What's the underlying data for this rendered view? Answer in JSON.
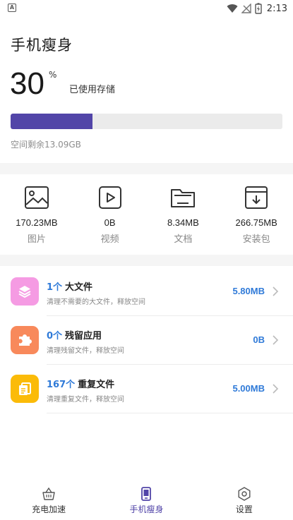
{
  "status_bar": {
    "left_icon": "A",
    "time": "2:13",
    "icons": [
      "wifi-icon",
      "no-signal-icon",
      "battery-charging-icon"
    ]
  },
  "header": {
    "title": "手机瘦身"
  },
  "storage": {
    "percent": "30",
    "unit": "%",
    "label": "已使用存储",
    "used_fraction": 0.3,
    "space_left": "空间剩余13.09GB"
  },
  "categories": [
    {
      "icon": "image-icon",
      "size": "170.23MB",
      "label": "图片"
    },
    {
      "icon": "video-icon",
      "size": "0B",
      "label": "视频"
    },
    {
      "icon": "folder-icon",
      "size": "8.34MB",
      "label": "文档"
    },
    {
      "icon": "package-icon",
      "size": "266.75MB",
      "label": "安装包"
    }
  ],
  "clean_items": [
    {
      "icon": "layers-icon",
      "count": "1个",
      "name": "大文件",
      "desc": "清理不需要的大文件，释放空间",
      "size": "5.80MB",
      "color": "#f59be3"
    },
    {
      "icon": "puzzle-icon",
      "count": "0个",
      "name": "残留应用",
      "desc": "清理残留文件，释放空间",
      "size": "0B",
      "color": "#f8895b"
    },
    {
      "icon": "copy-icon",
      "count": "167个",
      "name": "重复文件",
      "desc": "清理重复文件，释放空间",
      "size": "5.00MB",
      "color": "#fbbb09"
    }
  ],
  "tabs": [
    {
      "icon": "basket-icon",
      "label": "充电加速",
      "active": false
    },
    {
      "icon": "phone-icon",
      "label": "手机瘦身",
      "active": true
    },
    {
      "icon": "gear-icon",
      "label": "设置",
      "active": false
    }
  ],
  "colors": {
    "accent": "#5245a8",
    "link_blue": "#2f7ad8",
    "track_gray": "#ebebeb"
  }
}
